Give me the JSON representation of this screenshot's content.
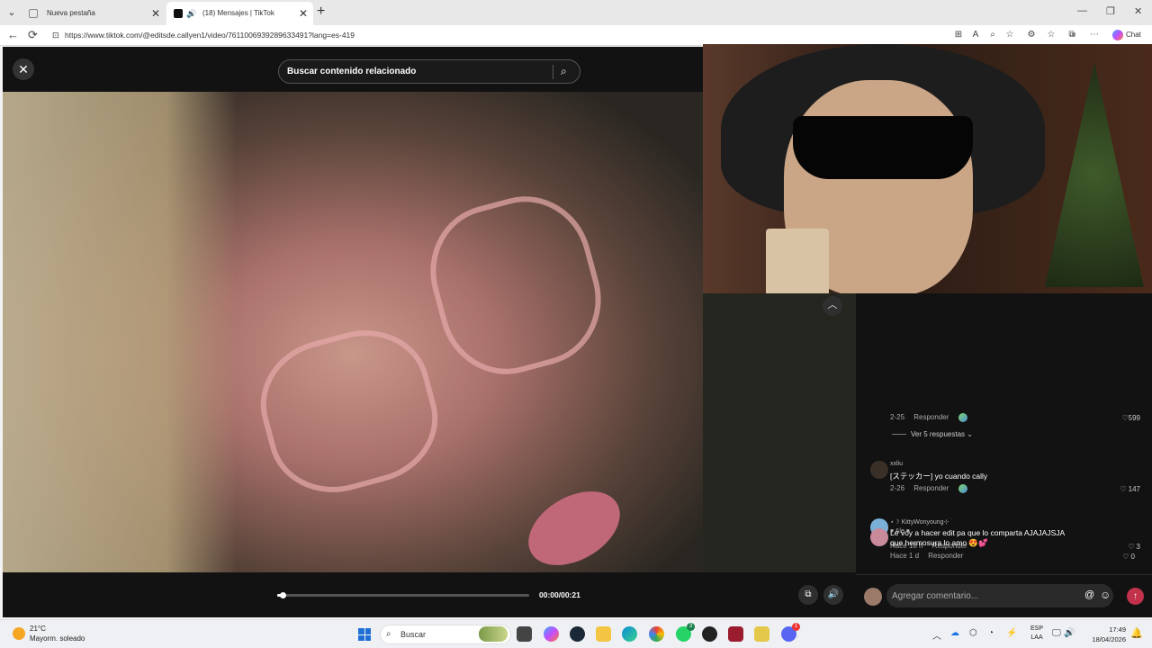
{
  "browser": {
    "tabs": [
      {
        "label": "Nueva pestaña",
        "active": false
      },
      {
        "label": "(18) Mensajes | TikTok",
        "active": true
      }
    ],
    "url": "https://www.tiktok.com/@editsde.callyen1/video/7611006939289633491?lang=es-419",
    "chat_label": "Chat",
    "menu_glyph": "⌄",
    "new_tab_glyph": "+",
    "tab_close_glyph": "✕",
    "window_controls": [
      "—",
      "❐",
      "✕"
    ],
    "nav_glyphs": {
      "back": "←",
      "reload": "⟳"
    },
    "toolbar_glyphs": [
      "⊞",
      "A",
      "⌕",
      "☆",
      "⚙",
      "☆",
      "⧉",
      "●",
      "⋯"
    ]
  },
  "tiktok": {
    "search_placeholder": "Buscar contenido relacionado",
    "close_glyph": "✕",
    "search_glyph": "⌕",
    "collapse_glyph": "︿",
    "player": {
      "time": "00:00/00:21",
      "progress": 0.02,
      "pip_glyph": "⧉",
      "volume_glyph": "🔊"
    },
    "first_comment": {
      "date": "2-25",
      "reply_label": "Responder",
      "likes": "599",
      "see_replies": "Ver 5 respuestas",
      "see_replies_chevron": "⌄"
    },
    "comments": [
      {
        "user": "xxliu",
        "text": "[ステッカー] yo cuando cally",
        "date": "2-26",
        "reply_label": "Responder",
        "likes": "147"
      },
      {
        "user": "⋆☽ KittyWonyoung⊹ ࣪",
        "text": "Le voy a hacer edit pa que lo comparta AJAJAJSJA",
        "date": "Hace 18 h",
        "reply_label": "Responder",
        "likes": "3"
      },
      {
        "user": "♥ Ale ♥",
        "text": "que hermosura lo amo 😍💕",
        "date": "Hace 1 d",
        "reply_label": "Responder",
        "likes": "0"
      }
    ],
    "heart_glyph": "♡",
    "comment_input_placeholder": "Agregar comentario...",
    "mention_glyph": "@",
    "emoji_glyph": "☺",
    "send_glyph": "↑"
  },
  "taskbar": {
    "temp": "21°C",
    "weather": "Mayorm. soleado",
    "search_label": "Buscar",
    "search_glyph": "⌕",
    "badges": {
      "phone": "3",
      "discord": "1"
    },
    "tray_glyphs": [
      "︿",
      "☁",
      "⬡",
      "◔",
      "⚡",
      "🎙"
    ],
    "tray_right_glyphs": [
      "🖵",
      "🔊",
      "🔋"
    ],
    "bell_glyph": "🔔",
    "lang_top": "ESP",
    "lang_bottom": "LAA",
    "time": "17:49",
    "date": "18/04/2026"
  },
  "colors": {
    "accent_send": "#c2334b",
    "player_bg": "#121212",
    "taskbar_bg": "#eef0f4"
  }
}
